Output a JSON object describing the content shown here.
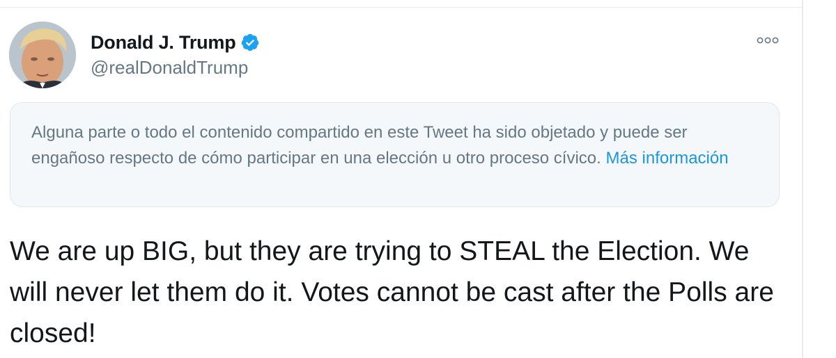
{
  "tweet": {
    "author": {
      "display_name": "Donald J. Trump",
      "handle": "@realDonaldTrump",
      "verified": true,
      "avatar_icon": "profile-photo-avatar"
    },
    "more_icon": "more-options-icon",
    "notice": {
      "text": "Alguna parte o todo el contenido compartido en este Tweet ha sido objetado y puede ser engañoso respecto de cómo participar en una elección u otro proceso cívico.",
      "link_label": "Más información"
    },
    "body": "We are up BIG, but they are trying to STEAL the Election. We will never let them do it. Votes cannot be cast after the Polls are closed!"
  },
  "colors": {
    "text_primary": "#14171a",
    "text_secondary": "#657786",
    "link": "#1b95e0",
    "verified_badge": "#1da1f2",
    "notice_background": "#f5f8fa",
    "border": "#e6ecf0"
  }
}
